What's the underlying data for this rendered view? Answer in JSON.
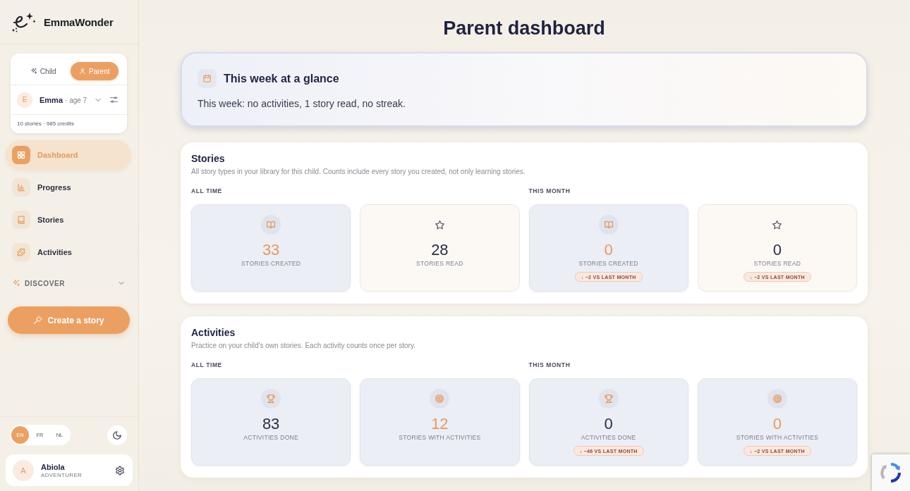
{
  "brand": {
    "name": "EmmaWonder"
  },
  "mode_switch": [
    {
      "label": "Child",
      "selected": false
    },
    {
      "label": "Parent",
      "selected": true
    }
  ],
  "child_profile": {
    "initial": "E",
    "name": "Emma",
    "age": "· age 7",
    "summary": "10 stories · 985 credits"
  },
  "nav": [
    {
      "label": "Dashboard",
      "selected": true
    },
    {
      "label": "Progress",
      "selected": false
    },
    {
      "label": "Stories",
      "selected": false
    },
    {
      "label": "Activities",
      "selected": false
    }
  ],
  "discover": {
    "label": "DISCOVER",
    "expanded": false
  },
  "create_button": {
    "label": "Create a story"
  },
  "languages": [
    {
      "label": "EN",
      "selected": true
    },
    {
      "label": "FR",
      "selected": false
    },
    {
      "label": "NL",
      "selected": false
    }
  ],
  "user": {
    "initial": "A",
    "name": "Abiola",
    "role": "ADVENTURER"
  },
  "page_title": "Parent dashboard",
  "glance": {
    "title": "This week at a glance",
    "summary": "This week: no activities, 1 story read, no streak."
  },
  "sections": [
    {
      "title": "Stories",
      "description": "All story types in your library for this child. Counts include every story you created, not only learning stories.",
      "groups": [
        {
          "label": "ALL TIME",
          "cards": [
            {
              "kind": "tinted",
              "accent": true,
              "value": "33",
              "label": "STORIES CREATED"
            },
            {
              "kind": "plain",
              "accent": false,
              "value": "28",
              "label": "STORIES READ"
            }
          ]
        },
        {
          "label": "THIS MONTH",
          "cards": [
            {
              "kind": "tinted",
              "accent": true,
              "value": "0",
              "label": "STORIES CREATED",
              "change": "↓ −2 VS LAST MONTH"
            },
            {
              "kind": "plain",
              "accent": false,
              "value": "0",
              "label": "STORIES READ",
              "change": "↓ −2 VS LAST MONTH"
            }
          ]
        }
      ]
    },
    {
      "title": "Activities",
      "description": "Practice on your child's own stories. Each activity counts once per story.",
      "groups": [
        {
          "label": "ALL TIME",
          "cards": [
            {
              "kind": "tinted",
              "accent": false,
              "value": "83",
              "label": "ACTIVITIES DONE"
            },
            {
              "kind": "tinted",
              "accent": true,
              "value": "12",
              "label": "STORIES WITH ACTIVITIES"
            }
          ]
        },
        {
          "label": "THIS MONTH",
          "cards": [
            {
              "kind": "tinted",
              "accent": false,
              "value": "0",
              "label": "ACTIVITIES DONE",
              "change": "↓ −46 VS LAST MONTH"
            },
            {
              "kind": "tinted",
              "accent": true,
              "value": "0",
              "label": "STORIES WITH ACTIVITIES",
              "change": "↓ −2 VS LAST MONTH"
            }
          ]
        }
      ]
    }
  ]
}
